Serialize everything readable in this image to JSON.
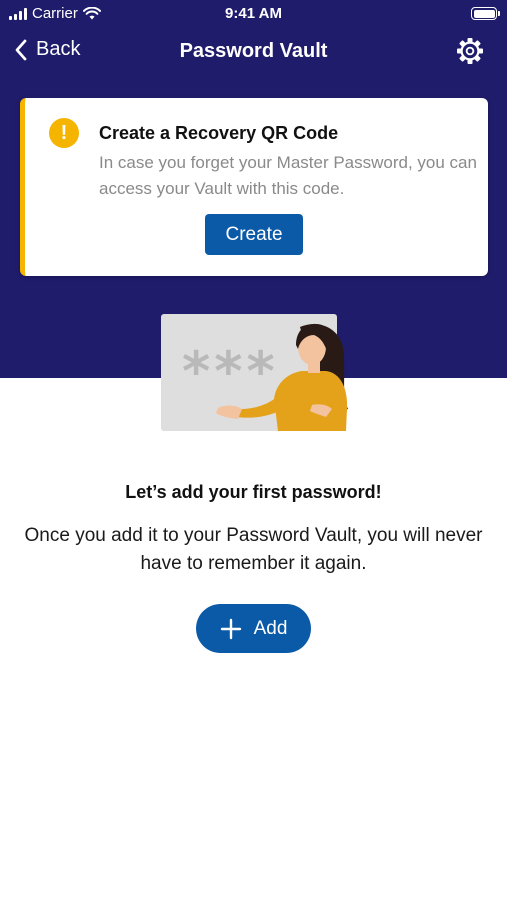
{
  "status_bar": {
    "carrier": "Carrier",
    "time": "9:41 AM",
    "battery_level": 1.0
  },
  "nav": {
    "back_label": "Back",
    "title": "Password Vault"
  },
  "recovery_card": {
    "title": "Create a Recovery QR Code",
    "description": "In case you forget your Master Password, you can access your Vault with this code.",
    "button_label": "Create",
    "accent_color": "#f5b400"
  },
  "illustration": {
    "mask_text": "***"
  },
  "empty_state": {
    "heading": "Let’s add your first password!",
    "description": "Once you add it to your Password Vault, you will never have to remember it again.",
    "add_label": "Add"
  },
  "colors": {
    "brand": "#1f1c6b",
    "button": "#0b5aa8",
    "warning": "#f5b400"
  },
  "icons": [
    "signal-icon",
    "wifi-icon",
    "battery-icon",
    "chevron-left-icon",
    "gear-icon",
    "warning-icon",
    "plus-icon"
  ]
}
